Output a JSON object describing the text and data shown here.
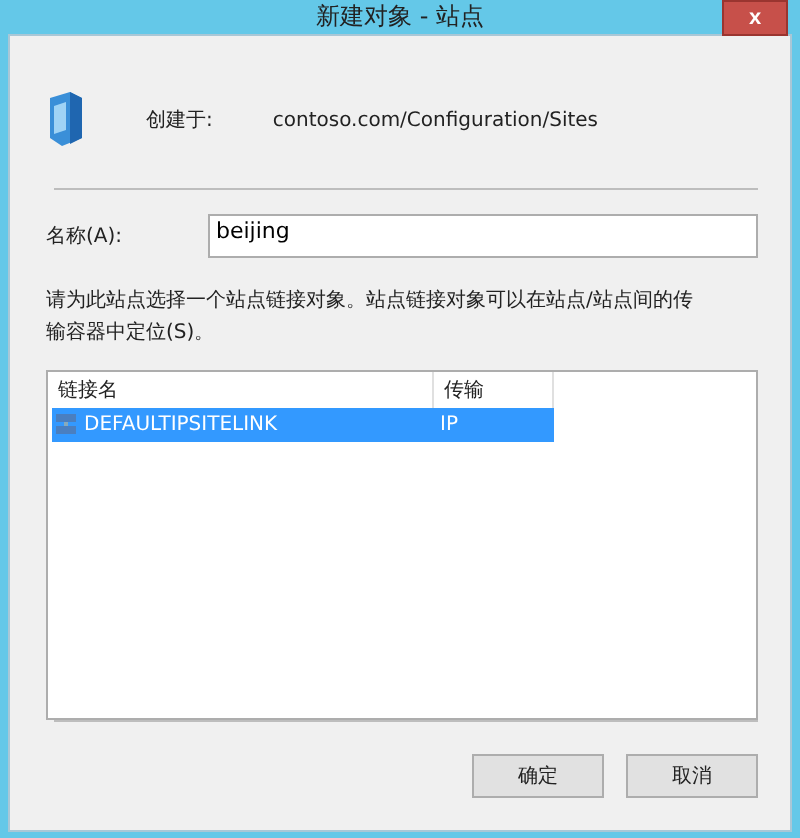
{
  "window": {
    "title": "新建对象 - 站点",
    "close": "x"
  },
  "created_in": {
    "label": "创建于:",
    "value": "contoso.com/Configuration/Sites"
  },
  "name_field": {
    "label": "名称(A):",
    "value": "beijing"
  },
  "instruction": "请为此站点选择一个站点链接对象。站点链接对象可以在站点/站点间的传输容器中定位(S)。",
  "table": {
    "columns": [
      "链接名",
      "传输"
    ],
    "rows": [
      {
        "cells": [
          "DEFAULTIPSITELINK",
          "IP"
        ],
        "selected": true
      }
    ]
  },
  "buttons": [
    "确定",
    "取消"
  ]
}
